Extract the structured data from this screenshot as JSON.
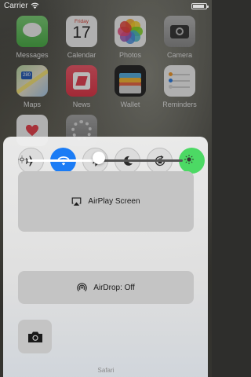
{
  "status_bar": {
    "carrier": "Carrier"
  },
  "home_screen": {
    "apps": [
      {
        "label": "Messages"
      },
      {
        "label": "Calendar",
        "weekday": "Friday",
        "date": "17"
      },
      {
        "label": "Photos"
      },
      {
        "label": "Camera"
      },
      {
        "label": "Maps",
        "shield": "280"
      },
      {
        "label": "News"
      },
      {
        "label": "Wallet"
      },
      {
        "label": "Reminders"
      }
    ]
  },
  "control_center": {
    "toggles": [
      {
        "name": "airplane-mode",
        "icon": "airplane-icon",
        "on": false
      },
      {
        "name": "wifi",
        "icon": "wifi-icon",
        "on": true,
        "color": "#1b7cf5"
      },
      {
        "name": "bluetooth",
        "icon": "bluetooth-icon",
        "on": false
      },
      {
        "name": "do-not-disturb",
        "icon": "moon-icon",
        "on": false
      },
      {
        "name": "rotation-lock",
        "icon": "rotation-lock-icon",
        "on": false
      },
      {
        "name": "extra-toggle",
        "icon": "",
        "on": true,
        "color": "#4cd964"
      }
    ],
    "brightness": {
      "level": 0.46
    },
    "airplay": {
      "label": "AirPlay Screen"
    },
    "airdrop": {
      "label": "AirDrop: Off"
    },
    "camera_shortcut": {
      "icon": "camera-icon"
    }
  },
  "bottom_hint": {
    "label": "Safari"
  }
}
